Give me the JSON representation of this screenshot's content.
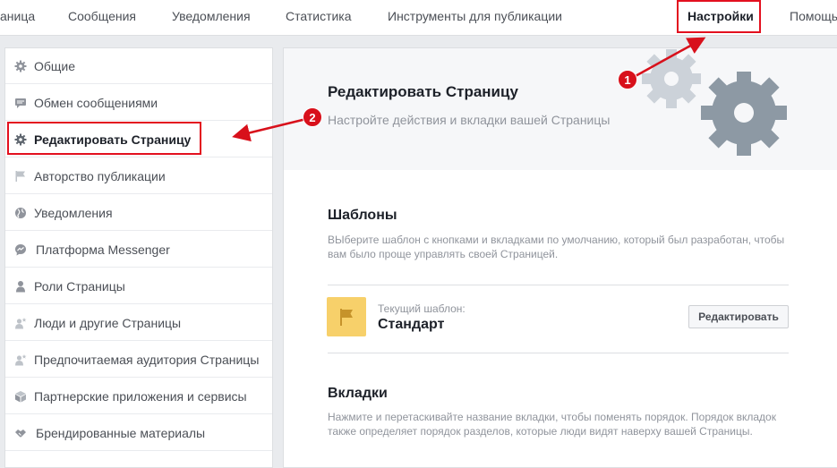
{
  "topnav": {
    "tabs": [
      {
        "label": "аница"
      },
      {
        "label": "Сообщения"
      },
      {
        "label": "Уведомления"
      },
      {
        "label": "Статистика"
      },
      {
        "label": "Инструменты для публикации"
      },
      {
        "label": "Настройки",
        "active": true
      },
      {
        "label": "Помощь"
      }
    ]
  },
  "sidebar": {
    "items": [
      {
        "label": "Общие",
        "icon": "gear-icon"
      },
      {
        "label": "Обмен сообщениями",
        "icon": "message-icon"
      },
      {
        "label": "Редактировать Страницу",
        "icon": "gear-icon",
        "active": true
      },
      {
        "label": "Авторство публикации",
        "icon": "flag-icon"
      },
      {
        "label": "Уведомления",
        "icon": "globe-icon"
      },
      {
        "label": "Платформа Messenger",
        "icon": "messenger-icon"
      },
      {
        "label": "Роли Страницы",
        "icon": "person-icon"
      },
      {
        "label": "Люди и другие Страницы",
        "icon": "person-star-icon"
      },
      {
        "label": "Предпочитаемая аудитория Страницы",
        "icon": "person-star-icon"
      },
      {
        "label": "Партнерские приложения и сервисы",
        "icon": "cube-icon"
      },
      {
        "label": "Брендированные материалы",
        "icon": "handshake-icon"
      }
    ]
  },
  "main": {
    "title": "Редактировать Страницу",
    "subtitle": "Настройте действия и вкладки вашей Страницы",
    "templates": {
      "title": "Шаблоны",
      "description": "ВЫберите шаблон с кнопками и вкладками по умолчанию, который был разработан, чтобы вам было проще управлять своей Страницей.",
      "current_label": "Текущий шаблон:",
      "current_name": "Стандарт",
      "edit_button": "Редактировать"
    },
    "tabs_section": {
      "title": "Вкладки",
      "description": "Нажмите и перетаскивайте название вкладки, чтобы поменять порядок. Порядок вкладок также определяет порядок разделов, которые люди видят наверху вашей Страницы."
    }
  },
  "annotations": {
    "badge_1": "1",
    "badge_2": "2"
  },
  "colors": {
    "highlight": "#e3101f",
    "gear_light": "#ccd2d9",
    "gear_dark": "#8d99a4",
    "template_icon_bg": "#f7d06a"
  }
}
